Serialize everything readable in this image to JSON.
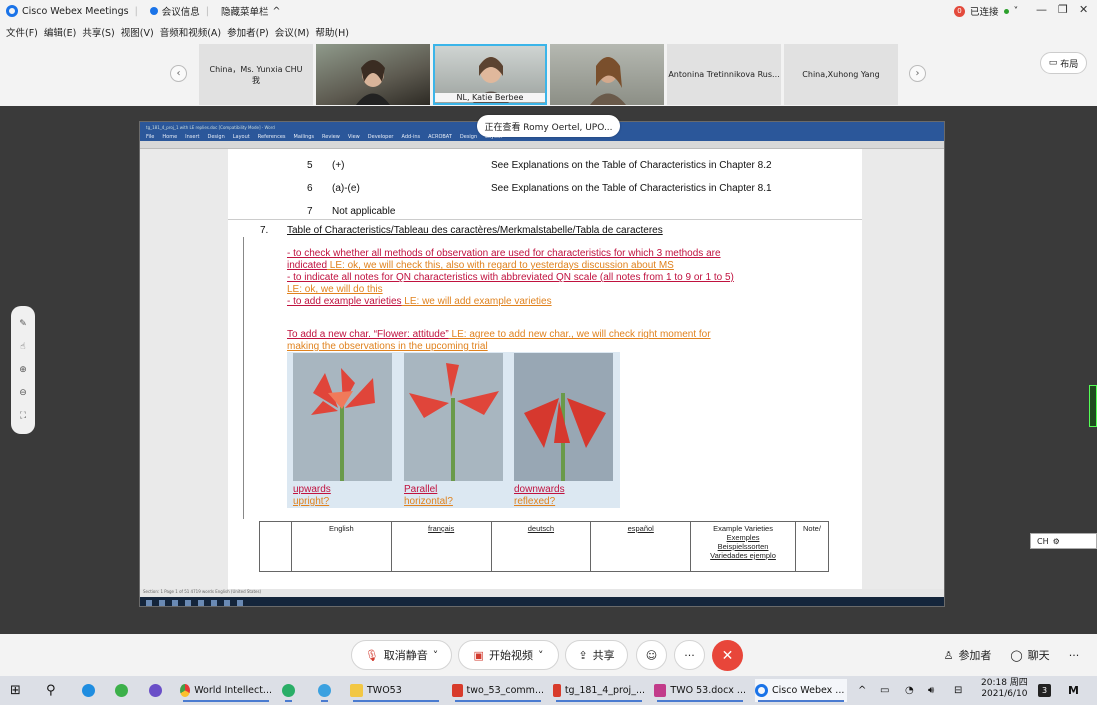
{
  "titlebar": {
    "app_title": "Cisco Webex Meetings",
    "meeting_info": "会议信息",
    "hide_menu": "隐藏菜单栏",
    "connected": "已连接",
    "notif_count": "0"
  },
  "menu": [
    "文件(F)",
    "编辑(E)",
    "共享(S)",
    "视图(V)",
    "音频和视频(A)",
    "参加者(P)",
    "会议(M)",
    "帮助(H)"
  ],
  "participants": {
    "p1_name": "China，Ms. Yunxia CHU",
    "p1_me": "我",
    "p3_name": "NL, Katie Berbee",
    "p5_name": "Antonina Tretinnikova Rus...",
    "p6_name": "China,Xuhong Yang"
  },
  "layout_label": "布局",
  "viewing": "正在查看 Romy Oertel, UPO...",
  "word": {
    "title": "tg_181_4_proj_1 with LE replies.doc [Compatibility Mode] - Word",
    "tabs": [
      "File",
      "Home",
      "Insert",
      "Design",
      "Layout",
      "References",
      "Mailings",
      "Review",
      "View",
      "Developer",
      "Add-ins",
      "ACROBAT",
      "Design",
      "Layout"
    ],
    "status": "Section: 1   Page 1 of 51   4719 words   English (United States)"
  },
  "doc": {
    "r5_num": "5",
    "r5_code": "(+)",
    "r5_text": "See Explanations on the Table of Characteristics in Chapter 8.2",
    "r6_num": "6",
    "r6_code": "(a)-(e)",
    "r6_text": "See Explanations on the Table of Characteristics in Chapter 8.1",
    "r7_num": "7",
    "r7_text": "Not applicable",
    "sec_num": "7.",
    "sec_title": "Table of Characteristics/Tableau des caractères/Merkmalstabelle/Tabla de caracteres",
    "l1a": "- to check whether all methods of observation are used for characteristics for which 3 methods are",
    "l1b": "indicated",
    "l1c": " LE: ok, we will check this, also with regard to yesterdays discussion about MS",
    "l2a": "- to indicate all notes for QN characteristics with abbreviated QN scale (all notes from 1 to 9 or 1 to 5)",
    "l2b": "LE: ok, we will do this",
    "l3a": "- to add example varieties",
    "l3b": " LE: we will add example varieties",
    "l4a": "To add a new char. “Flower: attitude”",
    "l4b": " LE: agree to add new char., we will check right moment for",
    "l4c": "making the observations in the upcoming trial",
    "cap1a": "upwards",
    "cap1b": "upright?",
    "cap2a": "Parallel",
    "cap2b": "horizontal?",
    "cap3a": "downwards",
    "cap3b": "reflexed?",
    "th_en": "English",
    "th_fr": "français",
    "th_de": "deutsch",
    "th_es": "español",
    "th_ex1": "Example Varieties",
    "th_ex2": "Exemples",
    "th_ex3": "Beispielssorten",
    "th_ex4": "Variedades ejemplo",
    "th_note": "Note/"
  },
  "ime": "CH",
  "controls": {
    "mute": "取消静音",
    "video": "开始视频",
    "share": "共享",
    "participants": "参加者",
    "chat": "聊天"
  },
  "taskbar": {
    "app1": "World Intellect...",
    "app2": "TWO53",
    "app3": "two_53_comm...",
    "app4": "tg_181_4_proj_...",
    "app5": "TWO 53.docx ...",
    "app6": "Cisco Webex ...",
    "time": "20:18 周四",
    "date": "2021/6/10",
    "badge": "3"
  },
  "colors": {
    "accent": "#1a73e8",
    "end": "#e8463a",
    "doc_red": "#c0123f",
    "doc_orange": "#e0821e"
  }
}
